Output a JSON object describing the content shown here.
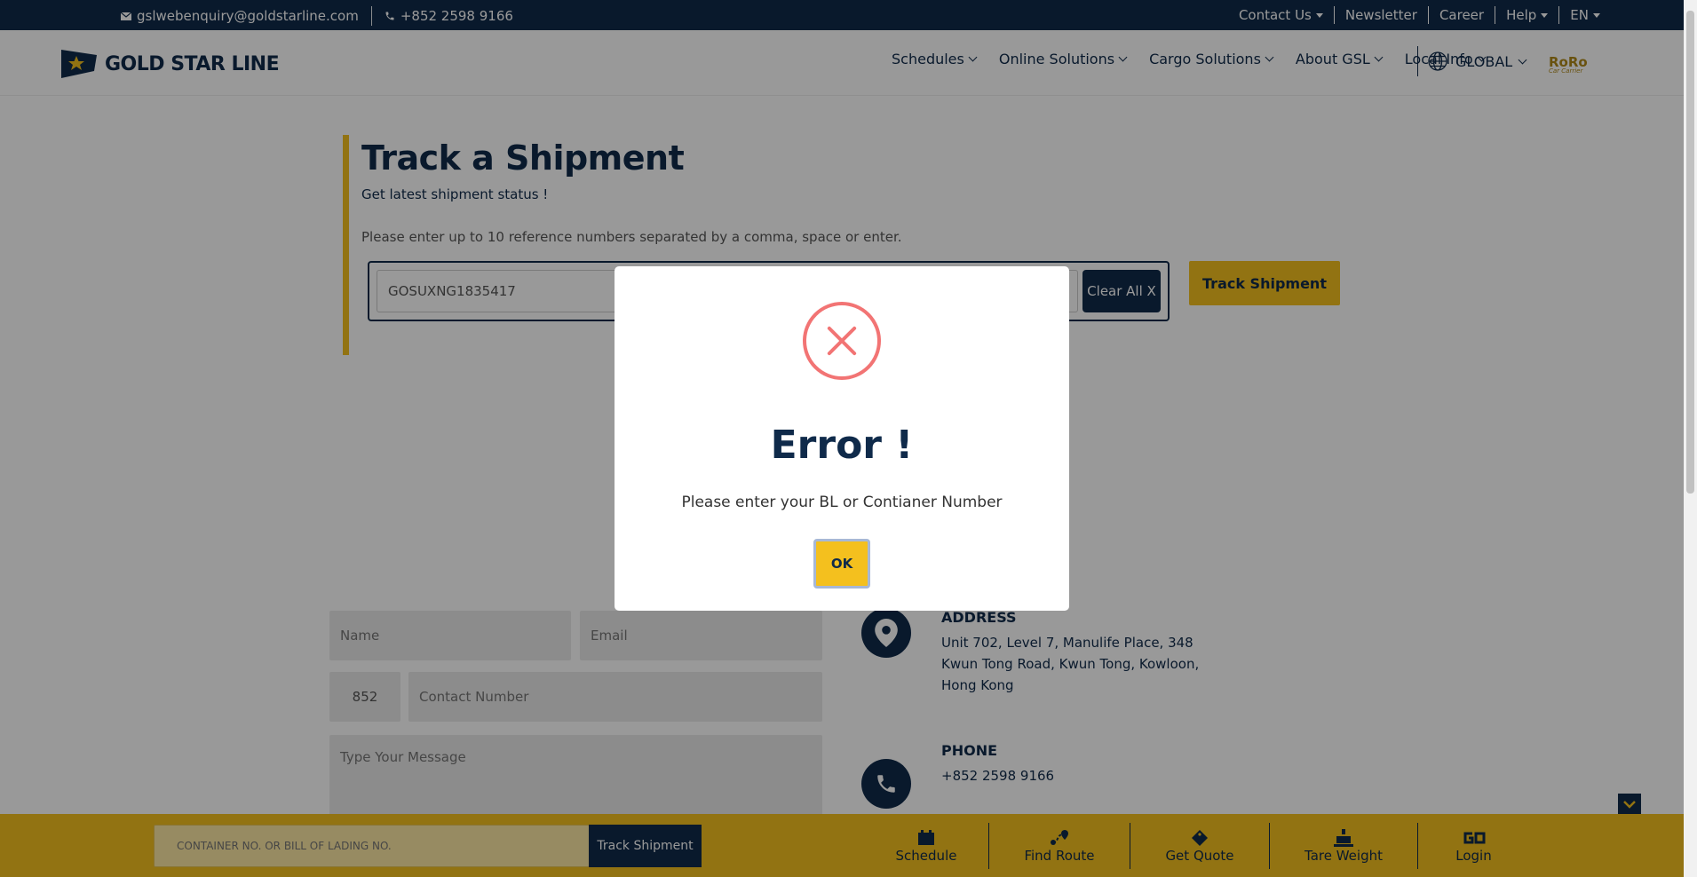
{
  "topbar": {
    "email": "gslwebenquiry@goldstarline.com",
    "phone": "+852 2598 9166",
    "links": [
      "Contact Us",
      "Newsletter",
      "Career",
      "Help",
      "EN"
    ]
  },
  "nav": {
    "logo_text": "GOLD STAR LINE",
    "items": [
      "Schedules",
      "Online Solutions",
      "Cargo Solutions",
      "About GSL",
      "Local Info"
    ],
    "region": "GLOBAL",
    "roro_brand": "RoRo",
    "roro_sub": "Car Carrier"
  },
  "track": {
    "title": "Track a Shipment",
    "subtitle": "Get latest shipment status !",
    "instruction": "Please enter up to 10 reference numbers separated by a comma, space or enter.",
    "reference_value": "GOSUXNG1835417",
    "clear_label": "Clear All X",
    "track_label": "Track Shipment"
  },
  "form": {
    "name_placeholder": "Name",
    "email_placeholder": "Email",
    "country_code": "852",
    "phone_placeholder": "Contact Number",
    "message_placeholder": "Type Your Message"
  },
  "contact": {
    "address_label": "ADDRESS",
    "address_lines": [
      "Unit 702, Level 7, Manulife Place, 348",
      "Kwun Tong Road, Kwun Tong, Kowloon,",
      "Hong Kong"
    ],
    "phone_label": "PHONE",
    "phone_value": "+852 2598 9166"
  },
  "bottombar": {
    "placeholder": "CONTAINER NO. OR BILL OF LADING NO.",
    "track_label": "Track Shipment",
    "tools": [
      "Schedule",
      "Find Route",
      "Get Quote",
      "Tare Weight",
      "Login"
    ]
  },
  "modal": {
    "title": "Error !",
    "message": "Please enter your BL or Contianer Number",
    "ok_label": "OK"
  },
  "colors": {
    "navy": "#0f2a4a",
    "gold": "#f4c01e",
    "error_red": "#f27474"
  }
}
